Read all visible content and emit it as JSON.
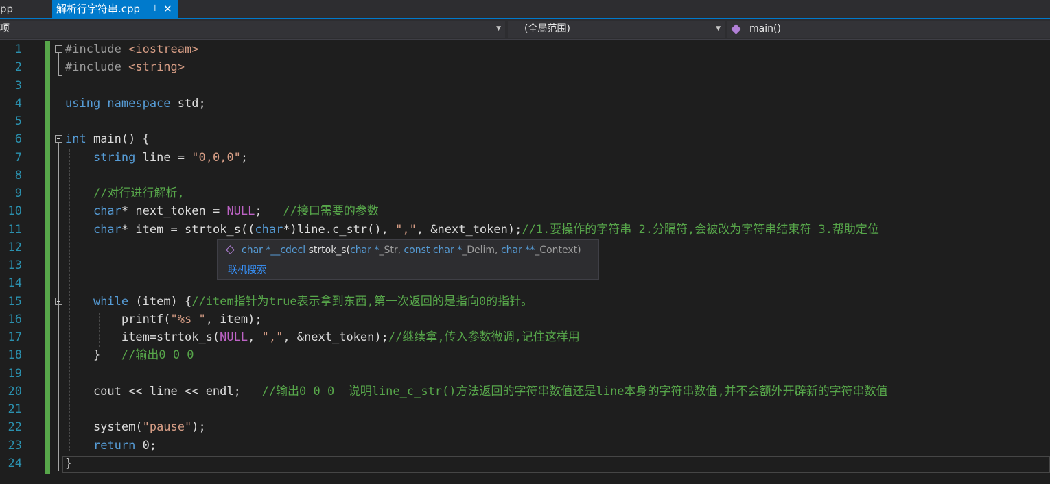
{
  "tabs": [
    {
      "label": "pp",
      "active": false
    },
    {
      "label": "解析行字符串.cpp",
      "active": true,
      "pin_icon": "pin-icon",
      "close_icon": "close-icon"
    }
  ],
  "nav": {
    "project_combo": "项",
    "scope_combo": "(全局范围)",
    "member_combo": "main()"
  },
  "tooltip": {
    "signature_parts": [
      "char *",
      "__cdecl",
      " strtok_s(",
      "char *",
      "_Str, ",
      "const char *",
      "_Delim, ",
      "char **",
      "_Context)"
    ],
    "online_search": "联机搜索"
  },
  "line_numbers": [
    "1",
    "2",
    "3",
    "4",
    "5",
    "6",
    "7",
    "8",
    "9",
    "10",
    "11",
    "12",
    "13",
    "14",
    "15",
    "16",
    "17",
    "18",
    "19",
    "20",
    "21",
    "22",
    "23",
    "24"
  ],
  "code_lines": [
    {
      "n": 1,
      "tokens": [
        [
          "pp",
          "#include "
        ],
        [
          "inc",
          "<iostream>"
        ]
      ]
    },
    {
      "n": 2,
      "tokens": [
        [
          "pp",
          "#include "
        ],
        [
          "inc",
          "<string>"
        ]
      ]
    },
    {
      "n": 3,
      "tokens": []
    },
    {
      "n": 4,
      "tokens": [
        [
          "kw",
          "using namespace "
        ],
        [
          "",
          "std;"
        ]
      ]
    },
    {
      "n": 5,
      "tokens": []
    },
    {
      "n": 6,
      "tokens": [
        [
          "kw",
          "int"
        ],
        [
          "",
          " main() {"
        ]
      ]
    },
    {
      "n": 7,
      "tokens": [
        [
          "",
          "    "
        ],
        [
          "kw",
          "string"
        ],
        [
          "",
          " line = "
        ],
        [
          "str",
          "\"0,0,0\""
        ],
        [
          "",
          ";"
        ]
      ]
    },
    {
      "n": 8,
      "tokens": []
    },
    {
      "n": 9,
      "tokens": [
        [
          "",
          "    "
        ],
        [
          "cm",
          "//对行进行解析,"
        ]
      ]
    },
    {
      "n": 10,
      "tokens": [
        [
          "",
          "    "
        ],
        [
          "kw",
          "char"
        ],
        [
          "",
          "* next_token = "
        ],
        [
          "mac",
          "NULL"
        ],
        [
          "",
          ";   "
        ],
        [
          "cm",
          "//接口需要的参数"
        ]
      ]
    },
    {
      "n": 11,
      "tokens": [
        [
          "",
          "    "
        ],
        [
          "kw",
          "char"
        ],
        [
          "",
          "* item = strtok_s(("
        ],
        [
          "kw",
          "char"
        ],
        [
          "",
          "*)line.c_str(), "
        ],
        [
          "str",
          "\",\""
        ],
        [
          "",
          ", &next_token);"
        ],
        [
          "cm",
          "//1.要操作的字符串 2.分隔符,会被改为字符串结束符 3.帮助定位"
        ]
      ]
    },
    {
      "n": 12,
      "tokens": []
    },
    {
      "n": 13,
      "tokens": []
    },
    {
      "n": 14,
      "tokens": []
    },
    {
      "n": 15,
      "tokens": [
        [
          "",
          "    "
        ],
        [
          "kw",
          "while"
        ],
        [
          "",
          " (item) {"
        ],
        [
          "cm",
          "//item指针为true表示拿到东西,第一次返回的是指向0的指针。"
        ]
      ]
    },
    {
      "n": 16,
      "tokens": [
        [
          "",
          "        printf("
        ],
        [
          "str",
          "\"%s \""
        ],
        [
          "",
          ", item);"
        ]
      ]
    },
    {
      "n": 17,
      "tokens": [
        [
          "",
          "        item=strtok_s("
        ],
        [
          "mac",
          "NULL"
        ],
        [
          "",
          ", "
        ],
        [
          "str",
          "\",\""
        ],
        [
          "",
          ", &next_token);"
        ],
        [
          "cm",
          "//继续拿,传入参数微调,记住这样用"
        ]
      ]
    },
    {
      "n": 18,
      "tokens": [
        [
          "",
          "    }   "
        ],
        [
          "cm",
          "//输出0 0 0"
        ]
      ]
    },
    {
      "n": 19,
      "tokens": []
    },
    {
      "n": 20,
      "tokens": [
        [
          "",
          "    cout << line << endl;   "
        ],
        [
          "cm",
          "//输出0 0 0  说明line_c_str()方法返回的字符串数值还是line本身的字符串数值,并不会额外开辟新的字符串数值"
        ]
      ]
    },
    {
      "n": 21,
      "tokens": []
    },
    {
      "n": 22,
      "tokens": [
        [
          "",
          "    system("
        ],
        [
          "str",
          "\"pause\""
        ],
        [
          "",
          ");"
        ]
      ]
    },
    {
      "n": 23,
      "tokens": [
        [
          "",
          "    "
        ],
        [
          "kw",
          "return"
        ],
        [
          "",
          " 0;"
        ]
      ]
    },
    {
      "n": 24,
      "tokens": [
        [
          "",
          "}"
        ]
      ]
    }
  ]
}
